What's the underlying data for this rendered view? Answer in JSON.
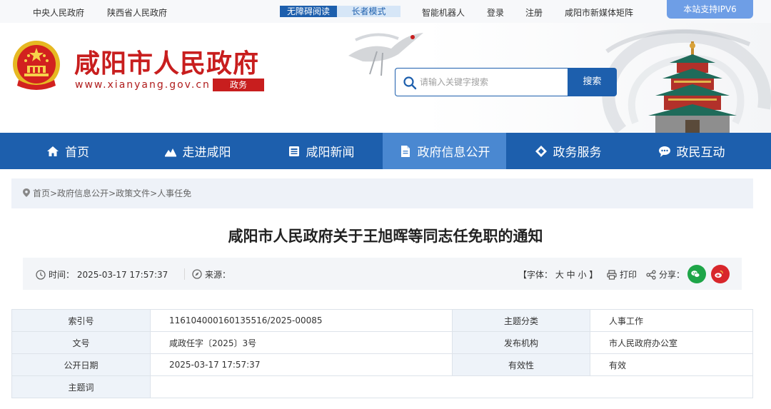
{
  "topbar": {
    "link_central": "中央人民政府",
    "link_province": "陕西省人民政府",
    "accessibility": "无障碍阅读",
    "elder_mode": "长者模式",
    "robot": "智能机器人",
    "login": "登录",
    "register": "注册",
    "media_matrix": "咸阳市新媒体矩阵",
    "ipv6": "本站支持IPV6"
  },
  "header": {
    "site_name": "咸阳市人民政府",
    "site_url": "www.xianyang.gov.cn",
    "site_tag": "政务",
    "search_placeholder": "请输入关键字搜索",
    "search_button": "搜索"
  },
  "nav": {
    "items": [
      {
        "label": "首页",
        "icon": "home-icon"
      },
      {
        "label": "走进咸阳",
        "icon": "mountain-icon"
      },
      {
        "label": "咸阳新闻",
        "icon": "newspaper-icon"
      },
      {
        "label": "政府信息公开",
        "icon": "document-icon"
      },
      {
        "label": "政务服务",
        "icon": "diamond-icon"
      },
      {
        "label": "政民互动",
        "icon": "chat-icon"
      }
    ],
    "active_index": 3
  },
  "breadcrumb": {
    "text": "首页>政府信息公开>政策文件>人事任免"
  },
  "article": {
    "title": "咸阳市人民政府关于王旭晖等同志任免职的通知",
    "time_label": "时间：",
    "time_value": "2025-03-17 17:57:37",
    "source_label": "来源：",
    "font_size": "【字体： 大 中 小 】",
    "print": "打印",
    "share": "分享："
  },
  "info_table": {
    "rows": [
      {
        "k1": "索引号",
        "v1": "116104000160135516/2025-00085",
        "k2": "主题分类",
        "v2": "人事工作"
      },
      {
        "k1": "文号",
        "v1": "咸政任字〔2025〕3号",
        "k2": "发布机构",
        "v2": "市人民政府办公室"
      },
      {
        "k1": "公开日期",
        "v1": "2025-03-17 17:57:37",
        "k2": "有效性",
        "v2": "有效"
      },
      {
        "k1": "主题词",
        "v1": ""
      }
    ]
  },
  "colors": {
    "brand_blue": "#1d5fad",
    "active_nav": "#4a88d1",
    "brand_red": "#c81e1e",
    "wechat_green": "#1ea548",
    "weibo_red": "#d8262b"
  }
}
